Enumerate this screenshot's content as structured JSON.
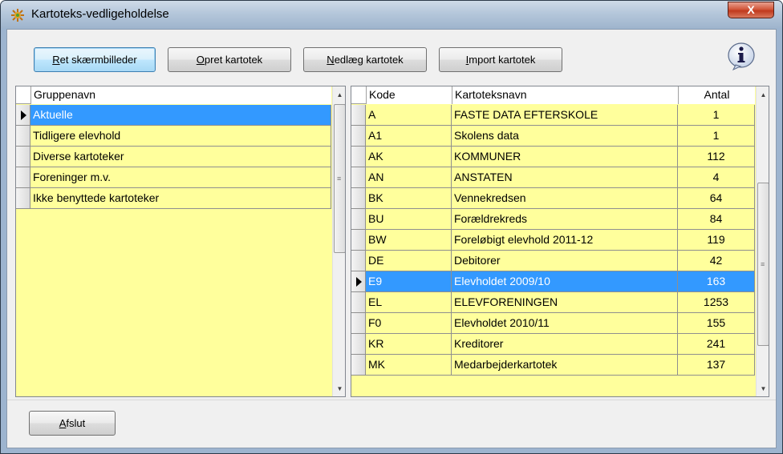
{
  "window": {
    "title": "Kartoteks-vedligeholdelse",
    "close_label": "X"
  },
  "toolbar": {
    "buttons": [
      {
        "label_u": "R",
        "label_rest": "et skærmbilleder"
      },
      {
        "label_u": "O",
        "label_rest": "pret kartotek"
      },
      {
        "label_u": "N",
        "label_rest": "edlæg kartotek"
      },
      {
        "label_u": "I",
        "label_rest": "mport kartotek"
      }
    ]
  },
  "groups": {
    "header": "Gruppenavn",
    "rows": [
      {
        "name": "Aktuelle",
        "selected": true
      },
      {
        "name": "Tidligere elevhold",
        "selected": false
      },
      {
        "name": "Diverse kartoteker",
        "selected": false
      },
      {
        "name": "Foreninger m.v.",
        "selected": false
      },
      {
        "name": "Ikke benyttede kartoteker",
        "selected": false
      }
    ]
  },
  "files": {
    "headers": {
      "code": "Kode",
      "name": "Kartoteksnavn",
      "count": "Antal"
    },
    "rows": [
      {
        "code": "A",
        "name": "FASTE DATA EFTERSKOLE",
        "count": "1"
      },
      {
        "code": "A1",
        "name": "Skolens data",
        "count": "1"
      },
      {
        "code": "AK",
        "name": "KOMMUNER",
        "count": "112"
      },
      {
        "code": "AN",
        "name": "ANSTATEN",
        "count": "4"
      },
      {
        "code": "BK",
        "name": "Vennekredsen",
        "count": "64"
      },
      {
        "code": "BU",
        "name": "Forældrekreds",
        "count": "84"
      },
      {
        "code": "BW",
        "name": "Foreløbigt elevhold 2011-12",
        "count": "119"
      },
      {
        "code": "DE",
        "name": "Debitorer",
        "count": "42"
      },
      {
        "code": "E9",
        "name": "Elevholdet 2009/10",
        "count": "163",
        "selected": true
      },
      {
        "code": "EL",
        "name": "ELEVFORENINGEN",
        "count": "1253"
      },
      {
        "code": "F0",
        "name": "Elevholdet 2010/11",
        "count": "155"
      },
      {
        "code": "KR",
        "name": "Kreditorer",
        "count": "241"
      },
      {
        "code": "MK",
        "name": "Medarbejderkartotek",
        "count": "137"
      }
    ]
  },
  "footer": {
    "exit_u": "A",
    "exit_rest": "fslut"
  }
}
